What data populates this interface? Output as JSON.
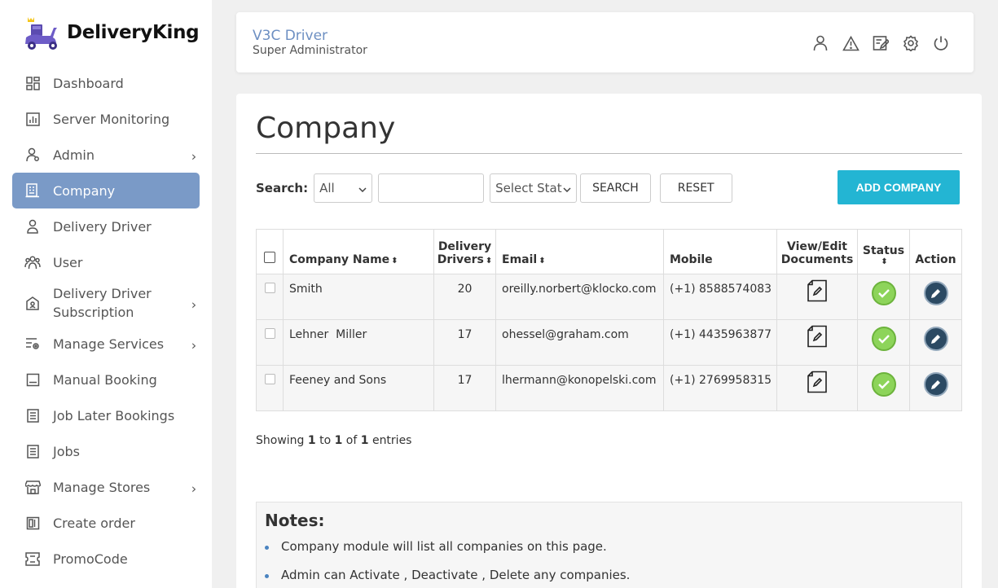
{
  "app": {
    "brand": "DeliveryKing"
  },
  "sidebar": {
    "items": [
      {
        "label": "Dashboard",
        "icon": "dashboard-icon",
        "submenu": false
      },
      {
        "label": "Server Monitoring",
        "icon": "chart-icon",
        "submenu": false
      },
      {
        "label": "Admin",
        "icon": "admin-user-icon",
        "submenu": true
      },
      {
        "label": "Company",
        "icon": "company-icon",
        "submenu": false,
        "active": true
      },
      {
        "label": "Delivery Driver",
        "icon": "driver-icon",
        "submenu": false
      },
      {
        "label": "User",
        "icon": "users-icon",
        "submenu": false
      },
      {
        "label": "Delivery Driver Subscription",
        "icon": "subscription-icon",
        "submenu": true
      },
      {
        "label": "Manage Services",
        "icon": "services-icon",
        "submenu": true
      },
      {
        "label": "Manual Booking",
        "icon": "booking-icon",
        "submenu": false
      },
      {
        "label": "Job Later Bookings",
        "icon": "document-icon",
        "submenu": false
      },
      {
        "label": "Jobs",
        "icon": "jobs-icon",
        "submenu": false
      },
      {
        "label": "Manage Stores",
        "icon": "store-icon",
        "submenu": true
      },
      {
        "label": "Create order",
        "icon": "order-icon",
        "submenu": false
      },
      {
        "label": "PromoCode",
        "icon": "promo-icon",
        "submenu": false
      }
    ],
    "caret": "›"
  },
  "header": {
    "user_name": "V3C Driver",
    "user_role": "Super Administrator",
    "icons": [
      "profile-icon",
      "alert-icon",
      "edit-notes-icon",
      "settings-icon",
      "power-icon"
    ]
  },
  "page": {
    "title": "Company",
    "search_label": "Search:",
    "search_scope": "All",
    "search_placeholder": "",
    "status_select": "Select Status",
    "search_button": "SEARCH",
    "reset_button": "RESET",
    "add_button": "ADD COMPANY"
  },
  "table": {
    "columns": {
      "company_name": "Company Name",
      "delivery_drivers_1": "Delivery",
      "delivery_drivers_2": "Drivers",
      "email": "Email",
      "mobile": "Mobile",
      "docs_1": "View/Edit",
      "docs_2": "Documents",
      "status": "Status",
      "action": "Action"
    },
    "rows": [
      {
        "name": "Smith",
        "drivers": "20",
        "email": "oreilly.norbert@klocko.com",
        "mobile": "(+1) 8588574083"
      },
      {
        "name": "Lehner  Miller",
        "drivers": "17",
        "email": "ohessel@graham.com",
        "mobile": "(+1) 4435963877"
      },
      {
        "name": "Feeney and Sons",
        "drivers": "17",
        "email": "lhermann@konopelski.com",
        "mobile": "(+1) 2769958315"
      }
    ]
  },
  "showing": {
    "prefix": "Showing ",
    "from": "1",
    "to_word": " to ",
    "to": "1",
    "of_word": " of ",
    "total": "1",
    "suffix": " entries"
  },
  "notes": {
    "title": "Notes:",
    "items": [
      "Company module will list all companies on this page.",
      "Admin can Activate , Deactivate , Delete any companies."
    ]
  },
  "colors": {
    "accent": "#7a9ac7",
    "add_button": "#23b5d3",
    "status_active": "#8dd45a",
    "link": "#4a83c0"
  }
}
